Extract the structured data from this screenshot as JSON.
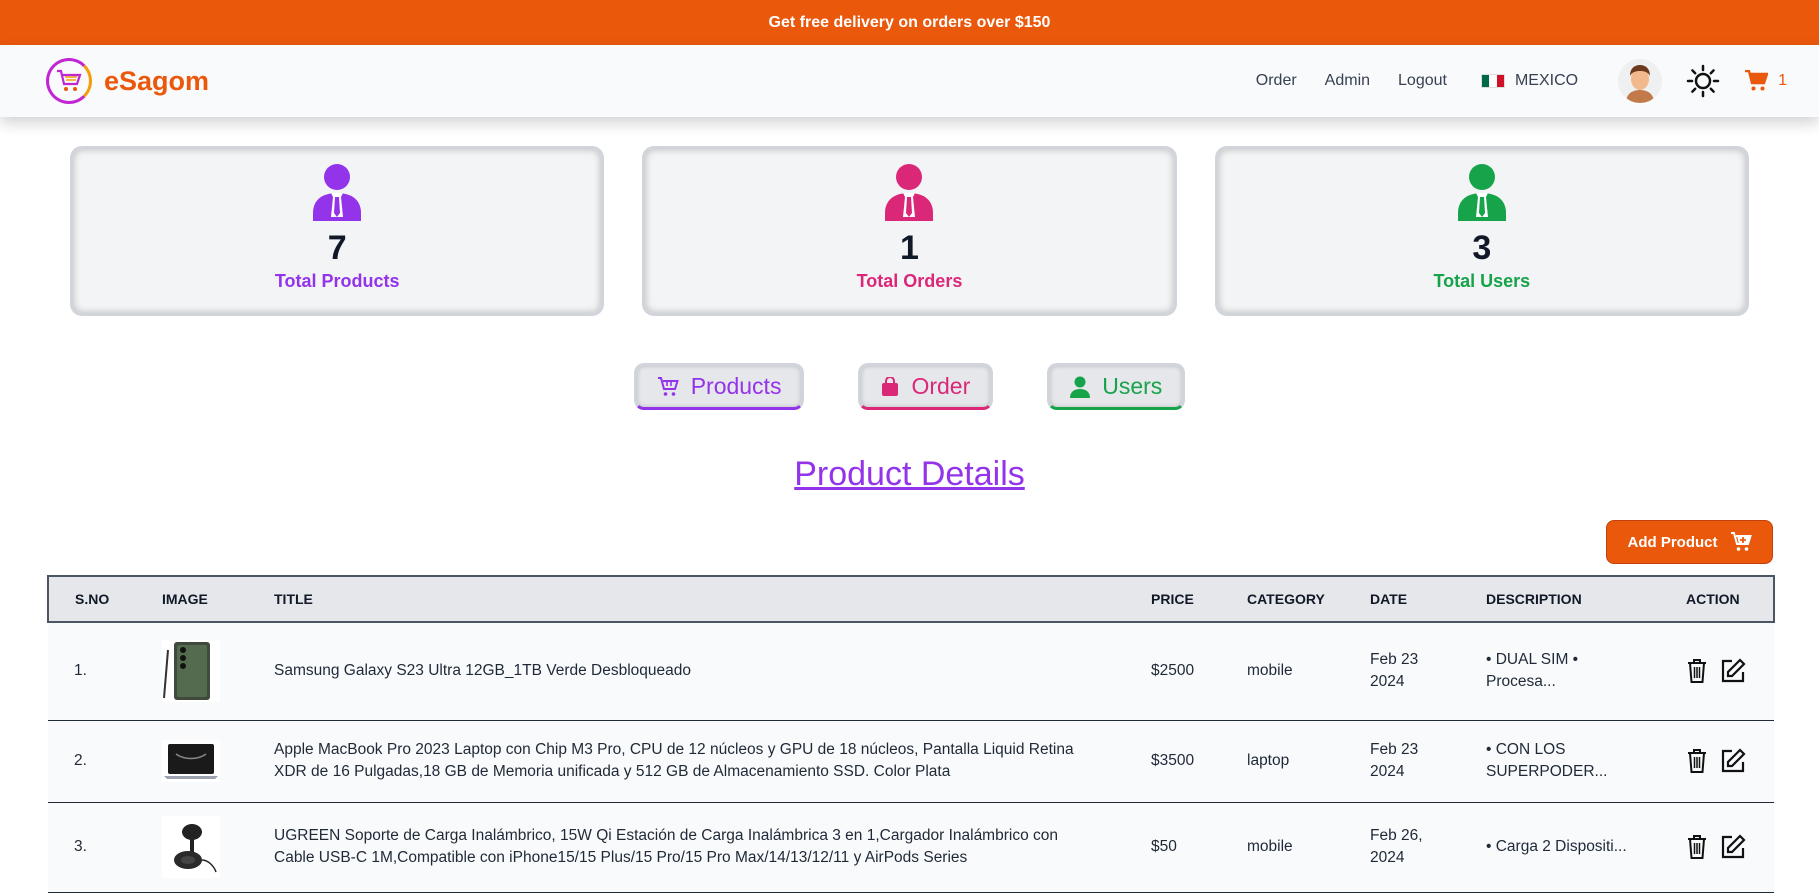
{
  "promo": "Get free delivery on orders over $150",
  "brand": "eSagom",
  "nav": {
    "links": [
      "Order",
      "Admin",
      "Logout"
    ],
    "country": "MEXICO",
    "cart_count": "1"
  },
  "stats": [
    {
      "value": "7",
      "label": "Total Products",
      "color": "#9333ea"
    },
    {
      "value": "1",
      "label": "Total Orders",
      "color": "#db2777"
    },
    {
      "value": "3",
      "label": "Total Users",
      "color": "#16a34a"
    }
  ],
  "tabs": [
    {
      "label": "Products",
      "color": "#9333ea",
      "icon": "cart-icon"
    },
    {
      "label": "Order",
      "color": "#db2777",
      "icon": "bag-icon"
    },
    {
      "label": "Users",
      "color": "#16a34a",
      "icon": "user-icon"
    }
  ],
  "section_title": "Product Details",
  "add_product": "Add Product",
  "table": {
    "headers": [
      "S.NO",
      "IMAGE",
      "TITLE",
      "PRICE",
      "CATEGORY",
      "DATE",
      "DESCRIPTION",
      "ACTION"
    ],
    "rows": [
      {
        "sno": "1.",
        "title": "Samsung Galaxy S23 Ultra 12GB_1TB Verde Desbloqueado",
        "price": "$2500",
        "category": "mobile",
        "date": "Feb 23 2024",
        "description": "• DUAL SIM • Procesa...",
        "image": "phone-image"
      },
      {
        "sno": "2.",
        "title": "Apple MacBook Pro 2023 Laptop con Chip M3 Pro, CPU de 12 núcleos y GPU de 18 núcleos, Pantalla Liquid Retina XDR de 16 Pulgadas,18 GB de Memoria unificada y 512 GB de Almacenamiento SSD. Color Plata",
        "price": "$3500",
        "category": "laptop",
        "date": "Feb 23 2024",
        "description": "• CON LOS SUPERPODER...",
        "image": "laptop-image"
      },
      {
        "sno": "3.",
        "title": "UGREEN Soporte de Carga Inalámbrico, 15W Qi Estación de Carga Inalámbrica 3 en 1,Cargador Inalámbrico con Cable USB-C 1M,Compatible con iPhone15/15 Plus/15 Pro/15 Pro Max/14/13/12/11 y AirPods Series",
        "price": "$50",
        "category": "mobile",
        "date": "Feb 26, 2024",
        "description": "• Carga 2 Dispositi...",
        "image": "charger-image"
      }
    ]
  }
}
